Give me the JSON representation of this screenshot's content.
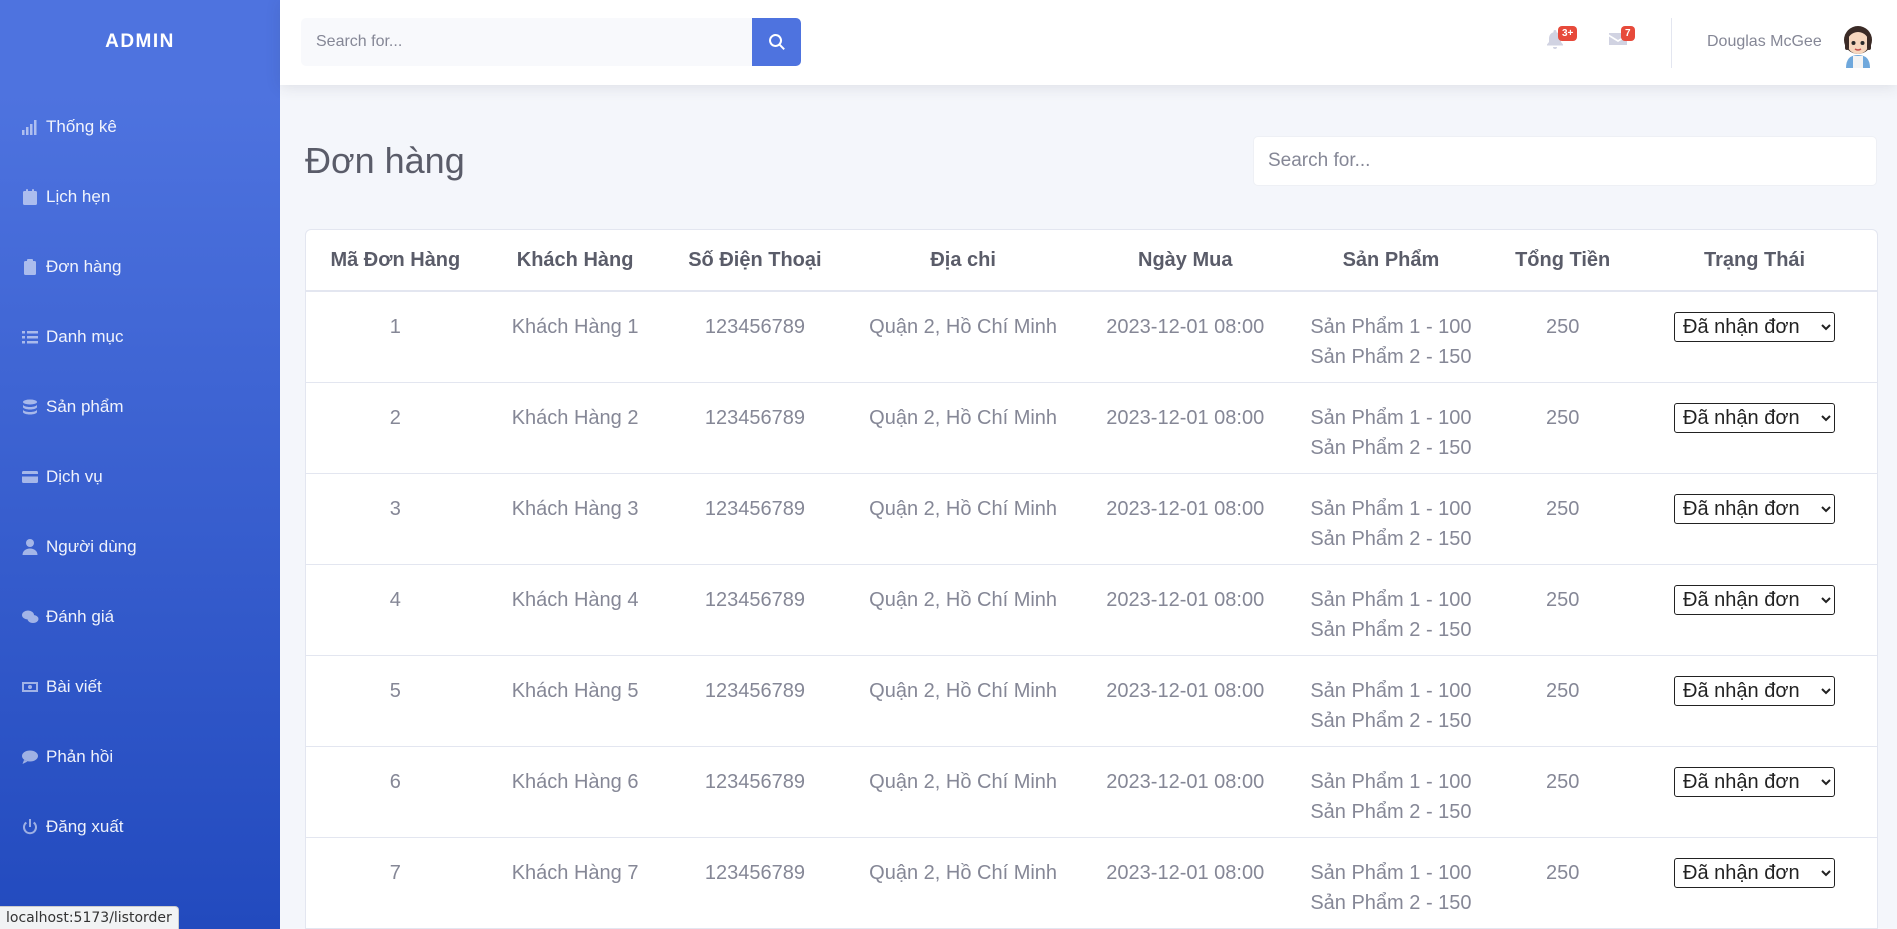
{
  "sidebar": {
    "brand": "ADMIN",
    "items": [
      {
        "label": "Thống kê",
        "icon": "chart-signal-icon"
      },
      {
        "label": "Lịch hẹn",
        "icon": "calendar-icon"
      },
      {
        "label": "Đơn hàng",
        "icon": "clipboard-icon"
      },
      {
        "label": "Danh mục",
        "icon": "list-icon"
      },
      {
        "label": "Sản phẩm",
        "icon": "coins-icon"
      },
      {
        "label": "Dịch vụ",
        "icon": "credit-card-icon"
      },
      {
        "label": "Người dùng",
        "icon": "user-icon"
      },
      {
        "label": "Đánh giá",
        "icon": "comments-icon"
      },
      {
        "label": "Bài viết",
        "icon": "money-bill-icon"
      },
      {
        "label": "Phản hồi",
        "icon": "comment-icon"
      },
      {
        "label": "Đăng xuất",
        "icon": "power-icon"
      }
    ]
  },
  "topbar": {
    "search_placeholder": "Search for...",
    "alerts_count": "3+",
    "messages_count": "7",
    "user_name": "Douglas McGee"
  },
  "main": {
    "title": "Đơn hàng",
    "search_placeholder": "Search for...",
    "columns": [
      "Mã Đơn Hàng",
      "Khách Hàng",
      "Số Điện Thoại",
      "Địa chi",
      "Ngày Mua",
      "Sản Phẩm",
      "Tổng Tiền",
      "Trạng Thái"
    ],
    "orders": [
      {
        "id": "1",
        "customer": "Khách Hàng 1",
        "phone": "123456789",
        "address": "Quận 2, Hồ Chí Minh",
        "date": "2023-12-01 08:00",
        "products": [
          "Sản Phẩm 1 - 100",
          "Sản Phẩm 2 - 150"
        ],
        "total": "250",
        "status": "Đã nhận đơn"
      },
      {
        "id": "2",
        "customer": "Khách Hàng 2",
        "phone": "123456789",
        "address": "Quận 2, Hồ Chí Minh",
        "date": "2023-12-01 08:00",
        "products": [
          "Sản Phẩm 1 - 100",
          "Sản Phẩm 2 - 150"
        ],
        "total": "250",
        "status": "Đã nhận đơn"
      },
      {
        "id": "3",
        "customer": "Khách Hàng 3",
        "phone": "123456789",
        "address": "Quận 2, Hồ Chí Minh",
        "date": "2023-12-01 08:00",
        "products": [
          "Sản Phẩm 1 - 100",
          "Sản Phẩm 2 - 150"
        ],
        "total": "250",
        "status": "Đã nhận đơn"
      },
      {
        "id": "4",
        "customer": "Khách Hàng 4",
        "phone": "123456789",
        "address": "Quận 2, Hồ Chí Minh",
        "date": "2023-12-01 08:00",
        "products": [
          "Sản Phẩm 1 - 100",
          "Sản Phẩm 2 - 150"
        ],
        "total": "250",
        "status": "Đã nhận đơn"
      },
      {
        "id": "5",
        "customer": "Khách Hàng 5",
        "phone": "123456789",
        "address": "Quận 2, Hồ Chí Minh",
        "date": "2023-12-01 08:00",
        "products": [
          "Sản Phẩm 1 - 100",
          "Sản Phẩm 2 - 150"
        ],
        "total": "250",
        "status": "Đã nhận đơn"
      },
      {
        "id": "6",
        "customer": "Khách Hàng 6",
        "phone": "123456789",
        "address": "Quận 2, Hồ Chí Minh",
        "date": "2023-12-01 08:00",
        "products": [
          "Sản Phẩm 1 - 100",
          "Sản Phẩm 2 - 150"
        ],
        "total": "250",
        "status": "Đã nhận đơn"
      },
      {
        "id": "7",
        "customer": "Khách Hàng 7",
        "phone": "123456789",
        "address": "Quận 2, Hồ Chí Minh",
        "date": "2023-12-01 08:00",
        "products": [
          "Sản Phẩm 1 - 100",
          "Sản Phẩm 2 - 150"
        ],
        "total": "250",
        "status": "Đã nhận đơn"
      }
    ]
  },
  "status_bar": {
    "url": "localhost:5173/listorder"
  },
  "colors": {
    "primary": "#4e73df",
    "primary_dark": "#224abe",
    "danger": "#e74a3b"
  }
}
